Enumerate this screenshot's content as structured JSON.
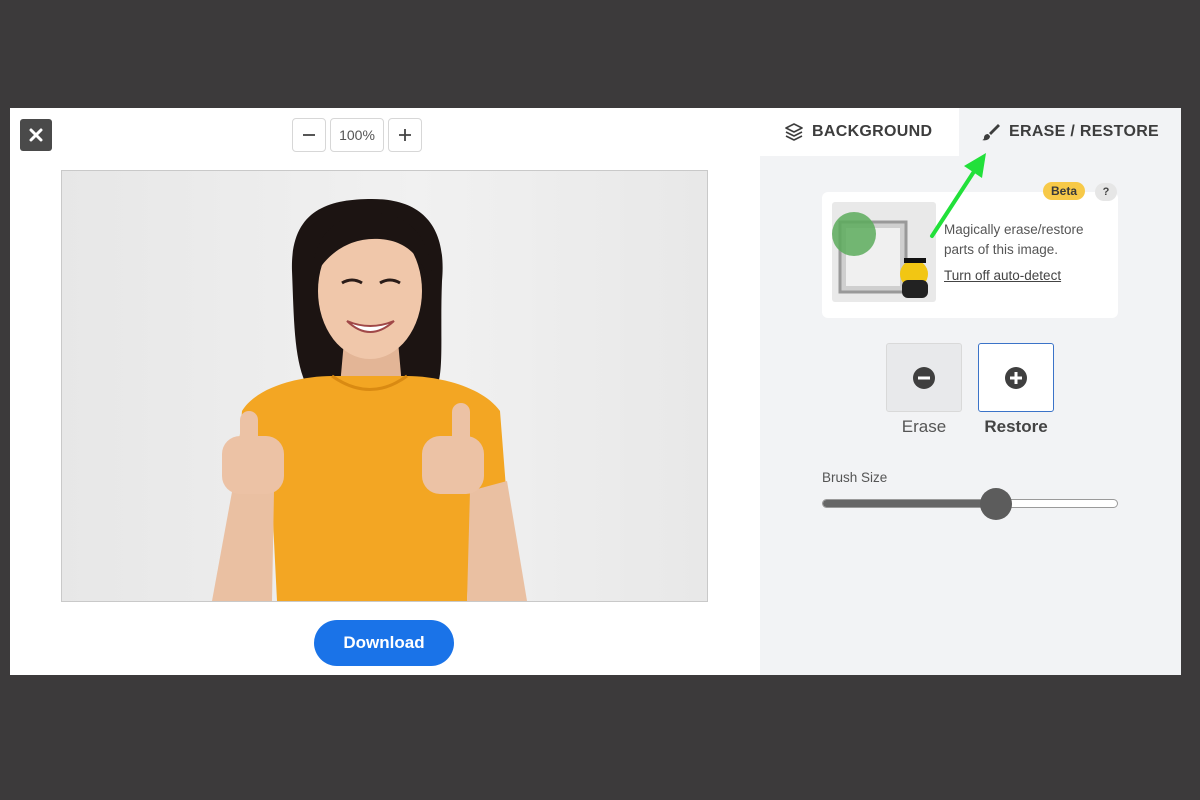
{
  "toolbar": {
    "close_icon": "close-icon",
    "zoom_out_icon": "minus-icon",
    "zoom_value": "100%",
    "zoom_in_icon": "plus-icon"
  },
  "editor": {
    "download_label": "Download",
    "accent_color": "#1a73e8"
  },
  "panel": {
    "tabs": [
      {
        "label": "BACKGROUND",
        "icon": "layers-icon"
      },
      {
        "label": "ERASE / RESTORE",
        "icon": "brush-icon"
      }
    ],
    "info": {
      "badge": "Beta",
      "help": "?",
      "text": "Magically erase/restore parts of this image.",
      "link": "Turn off auto-detect"
    },
    "modes": [
      {
        "label": "Erase",
        "icon": "minus-circle-icon",
        "selected": false
      },
      {
        "label": "Restore",
        "icon": "plus-circle-icon",
        "selected": true
      }
    ],
    "brush": {
      "label": "Brush Size",
      "value_fraction": 0.59
    }
  },
  "annotation": {
    "arrow_color": "#22e03a"
  }
}
